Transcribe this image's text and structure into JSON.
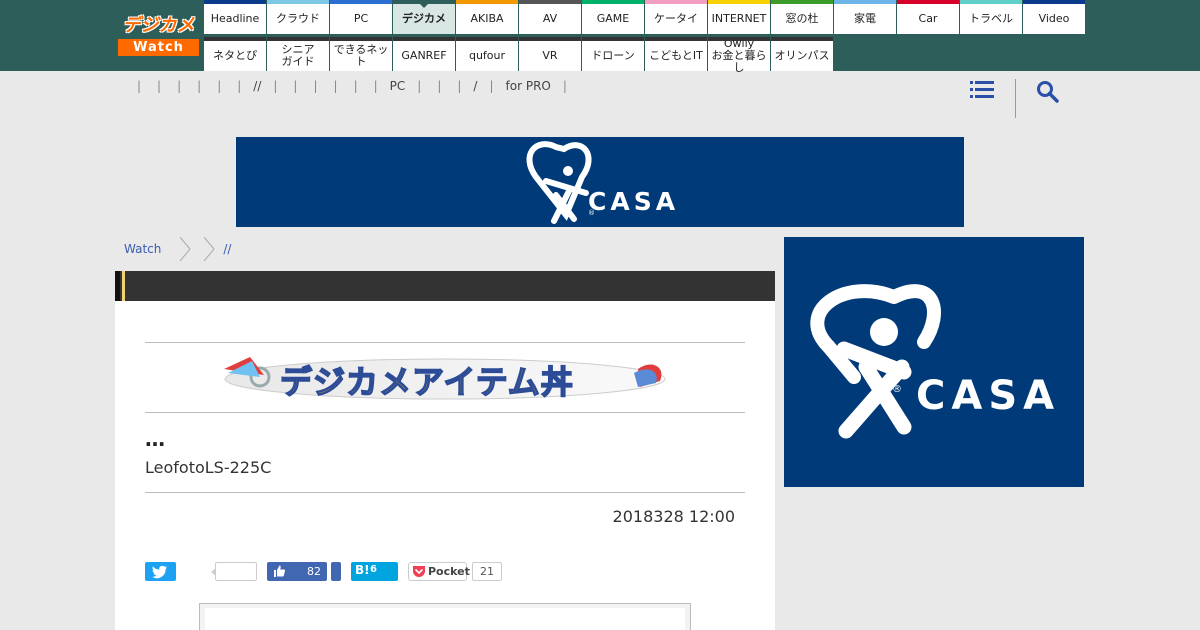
{
  "site": {
    "logo_top": "デジカメ",
    "logo_bottom": "Watch"
  },
  "nav": {
    "row1": [
      {
        "label": "Headline",
        "color": "#0a3a8c"
      },
      {
        "label": "クラウド",
        "color": "#7ec8e3"
      },
      {
        "label": "PC",
        "color": "#2b6fd1"
      },
      {
        "label": "デジカメ",
        "color": "#2e5e5a",
        "active": true
      },
      {
        "label": "AKIBA",
        "color": "#f39800"
      },
      {
        "label": "AV",
        "color": "#555555"
      },
      {
        "label": "GAME",
        "color": "#00b16a"
      },
      {
        "label": "ケータイ",
        "color": "#f19ec2"
      },
      {
        "label": "INTERNET",
        "color": "#f5d200"
      },
      {
        "label": "窓の杜",
        "color": "#3c9c2a"
      },
      {
        "label": "家電",
        "color": "#6fb4e8"
      },
      {
        "label": "Car",
        "color": "#d6002a"
      },
      {
        "label": "トラベル",
        "color": "#5fd0c8"
      },
      {
        "label": "Video",
        "color": "#0a3a8c"
      }
    ],
    "row2": [
      {
        "label": "ネタとぴ"
      },
      {
        "label": "シニア\nガイド"
      },
      {
        "label": "できるネット"
      },
      {
        "label": "GANREF"
      },
      {
        "label": "qufour"
      },
      {
        "label": "VR"
      },
      {
        "label": "ドローン"
      },
      {
        "label": "こどもとIT"
      },
      {
        "label": "Owlly\nお金と暮らし"
      },
      {
        "label": "オリンパス"
      }
    ]
  },
  "subnav": {
    "items": [
      "",
      "",
      "",
      "",
      "",
      "",
      "//",
      "",
      "",
      "",
      "",
      "",
      "PC",
      "",
      "",
      "/",
      "for PRO"
    ],
    "separator": "|"
  },
  "icons": {
    "menu": "hamburger-menu-icon",
    "search": "search-icon"
  },
  "ads": {
    "brand": "CASA",
    "registered": "®",
    "bg_color": "#003a78"
  },
  "breadcrumb": {
    "items": [
      "Watch",
      "",
      "//"
    ]
  },
  "article": {
    "banner_text": "デジカメアイテム丼",
    "headline": "…",
    "subtitle": "LeofotoLS-225C",
    "date": "2018328 12:00"
  },
  "social": {
    "like_count": "82",
    "hatena_label": "B!",
    "hatena_count": "6",
    "pocket_label": "Pocket",
    "pocket_count": "21"
  }
}
